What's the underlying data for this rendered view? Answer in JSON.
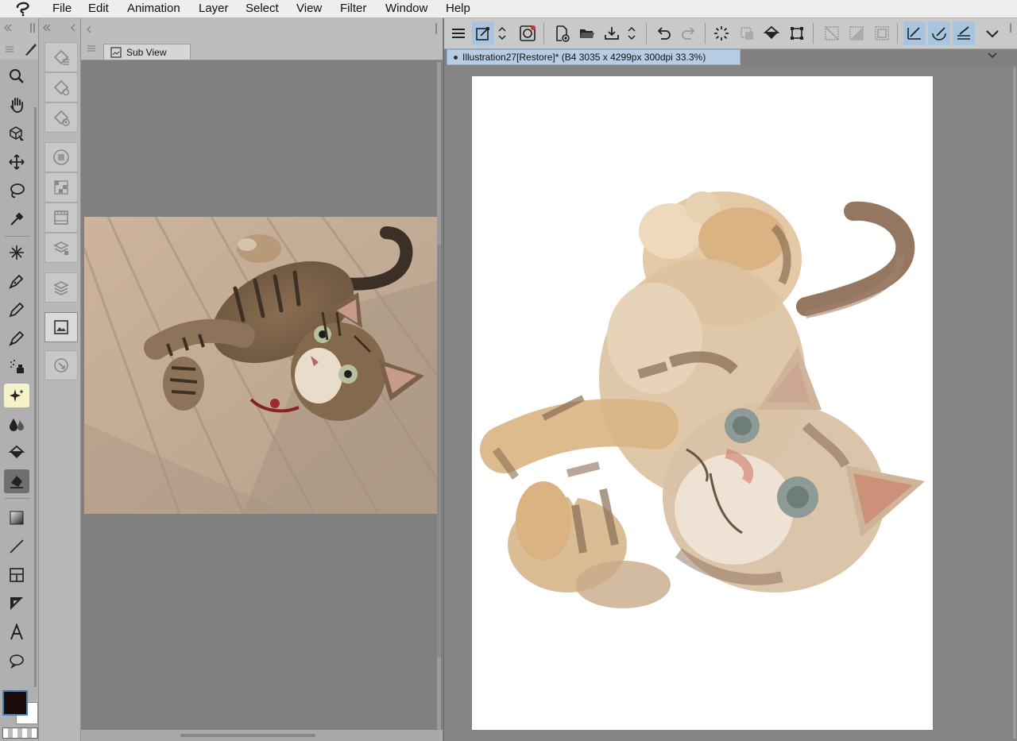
{
  "menu": {
    "items": [
      "File",
      "Edit",
      "Animation",
      "Layer",
      "Select",
      "View",
      "Filter",
      "Window",
      "Help"
    ]
  },
  "sub_view": {
    "tab_label": "Sub View"
  },
  "canvas": {
    "tab_label": "Illustration27[Restore]* (B4 3035 x 4299px 300dpi 33.3%)"
  },
  "tools": {
    "icons": [
      "zoom-icon",
      "hand-icon",
      "object-icon",
      "move-icon",
      "lasso-icon",
      "eyedropper-icon",
      "auto-select-icon",
      "pen-icon",
      "pencil-icon",
      "brush-icon",
      "airbrush-icon",
      "decoration-icon",
      "blend-icon",
      "fill-icon",
      "eraser-icon",
      "gradient-icon",
      "line-icon",
      "frame-icon",
      "ruler-icon",
      "text-icon",
      "balloon-icon"
    ],
    "active": "eraser-icon",
    "highlighted": "decoration-icon"
  },
  "colors": {
    "main_color": "#1a0a0a",
    "sub_color": "#ffffff",
    "accent": "#a7c4e0"
  }
}
